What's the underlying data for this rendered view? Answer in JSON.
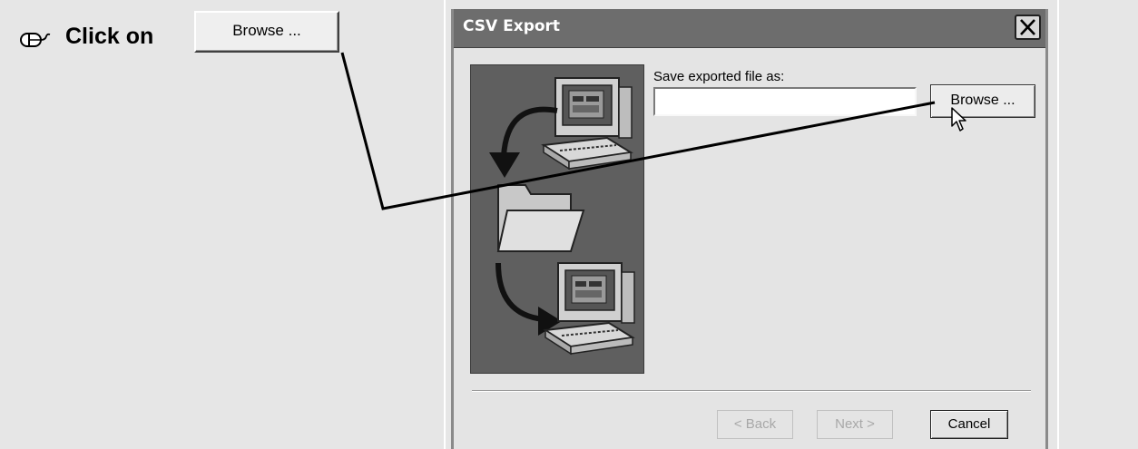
{
  "instruction": {
    "step_text": "Click on",
    "button_label": "Browse ..."
  },
  "dialog": {
    "title": "CSV Export",
    "save_label": "Save exported file as:",
    "file_input_value": "",
    "browse_label": "Browse ...",
    "back_label": "< Back",
    "next_label": "Next >",
    "cancel_label": "Cancel"
  },
  "icons": {
    "mouse": "mouse-icon",
    "close": "close-icon",
    "cursor": "arrow-cursor-icon",
    "wizard": "export-wizard-illustration"
  },
  "colors": {
    "titlebar": "#6d6d6d",
    "background": "#e6e6e6",
    "wizard_panel": "#5f5f5f"
  }
}
